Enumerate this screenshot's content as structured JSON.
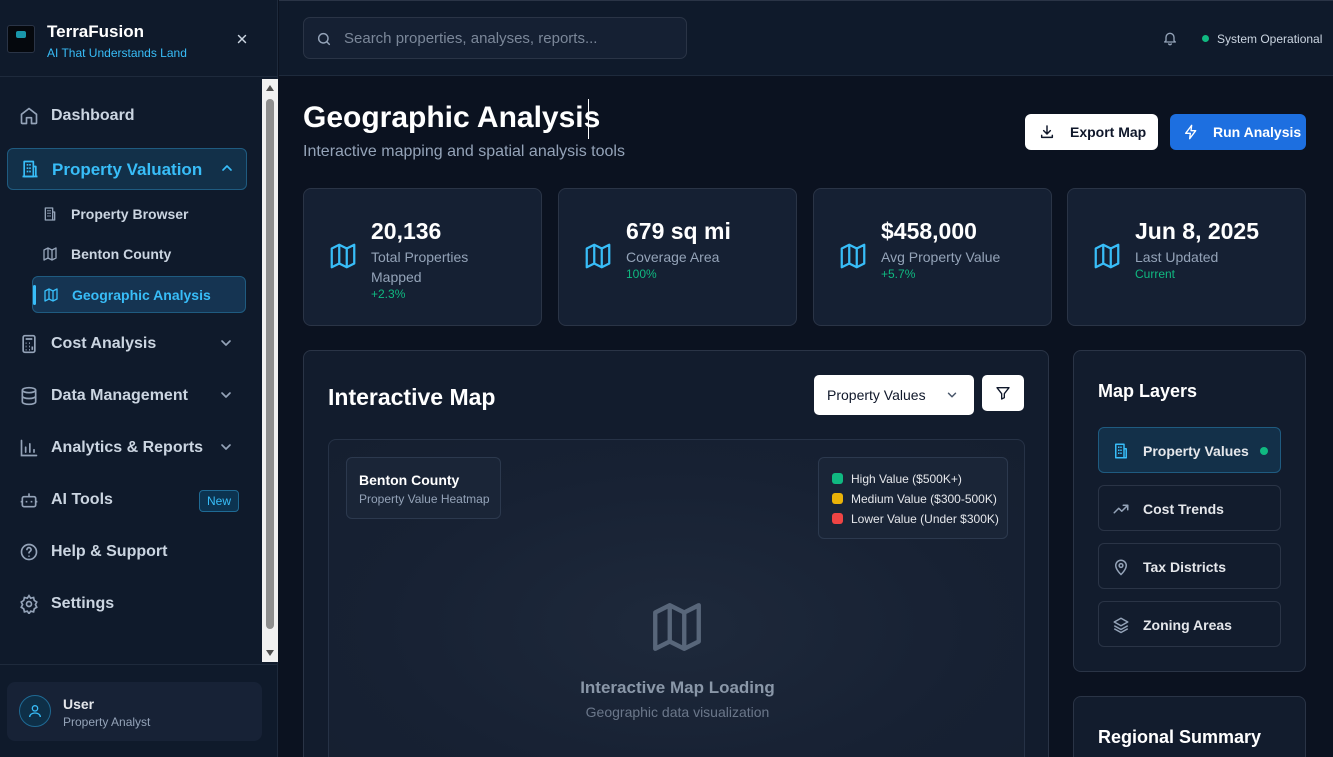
{
  "brand": {
    "name": "TerraFusion",
    "tagline": "AI That Understands Land"
  },
  "nav": {
    "items": [
      {
        "label": "Dashboard",
        "icon": "home-icon"
      },
      {
        "label": "Property Valuation",
        "icon": "building-icon",
        "expanded": true,
        "active": true
      },
      {
        "label": "Cost Analysis",
        "icon": "calculator-icon"
      },
      {
        "label": "Data Management",
        "icon": "database-icon"
      },
      {
        "label": "Analytics & Reports",
        "icon": "bar-chart-icon"
      },
      {
        "label": "AI Tools",
        "icon": "bot-icon",
        "badge": "New"
      },
      {
        "label": "Help & Support",
        "icon": "help-circle-icon"
      },
      {
        "label": "Settings",
        "icon": "gear-icon"
      }
    ],
    "sub_items": [
      {
        "label": "Property Browser",
        "icon": "building-icon"
      },
      {
        "label": "Benton County",
        "icon": "map-icon"
      },
      {
        "label": "Geographic Analysis",
        "icon": "map-icon",
        "active": true
      }
    ]
  },
  "user": {
    "name": "User",
    "role": "Property Analyst"
  },
  "header": {
    "search_placeholder": "Search properties, analyses, reports...",
    "status": "System Operational",
    "status_color": "#10b981"
  },
  "page": {
    "title": "Geographic Analysis",
    "subtitle": "Interactive mapping and spatial analysis tools",
    "export_label": "Export Map",
    "run_label": "Run Analysis"
  },
  "stats": [
    {
      "value": "20,136",
      "label": "Total Properties Mapped",
      "change": "+2.3%"
    },
    {
      "value": "679 sq mi",
      "label": "Coverage Area",
      "change": "100%"
    },
    {
      "value": "$458,000",
      "label": "Avg Property Value",
      "change": "+5.7%"
    },
    {
      "value": "Jun 8, 2025",
      "label": "Last Updated",
      "change": "Current"
    }
  ],
  "map": {
    "title": "Interactive Map",
    "select_value": "Property Values",
    "region_name": "Benton County",
    "region_sub": "Property Value Heatmap",
    "legend": [
      {
        "label": "High Value ($500K+)",
        "color": "#10b981"
      },
      {
        "label": "Medium Value ($300-500K)",
        "color": "#eab308"
      },
      {
        "label": "Lower Value (Under $300K)",
        "color": "#ef4444"
      }
    ],
    "loading_title": "Interactive Map Loading",
    "loading_sub": "Geographic data visualization"
  },
  "layers": {
    "title": "Map Layers",
    "items": [
      {
        "label": "Property Values",
        "icon": "building-icon",
        "active": true
      },
      {
        "label": "Cost Trends",
        "icon": "trending-up-icon"
      },
      {
        "label": "Tax Districts",
        "icon": "map-pin-icon"
      },
      {
        "label": "Zoning Areas",
        "icon": "layers-icon"
      }
    ]
  },
  "summary": {
    "title": "Regional Summary"
  },
  "colors": {
    "accent": "#38bdf8",
    "primary_button": "#1d6fe0",
    "positive": "#10b981"
  }
}
